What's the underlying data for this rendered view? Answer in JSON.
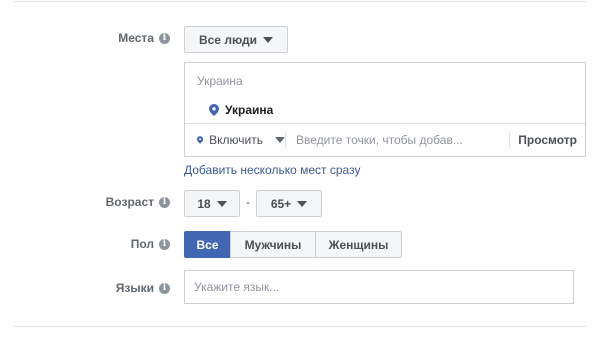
{
  "places": {
    "label": "Места",
    "people_dropdown": "Все люди",
    "country_header": "Украина",
    "selected_location": "Украина",
    "include_dropdown": "Включить",
    "search_placeholder": "Введите точки, чтобы добав...",
    "browse_button": "Просмотр",
    "add_multiple_link": "Добавить несколько мест сразу"
  },
  "age": {
    "label": "Возраст",
    "min": "18",
    "separator": "-",
    "max": "65+"
  },
  "gender": {
    "label": "Пол",
    "options": [
      "Все",
      "Мужчины",
      "Женщины"
    ],
    "selected": "Все"
  },
  "languages": {
    "label": "Языки",
    "placeholder": "Укажите язык..."
  },
  "colors": {
    "accent": "#4267b2",
    "link": "#385898",
    "pin": "#4267b2"
  },
  "icons": {
    "info": "info-icon",
    "caret": "caret-down-icon",
    "pin": "location-pin-icon"
  }
}
